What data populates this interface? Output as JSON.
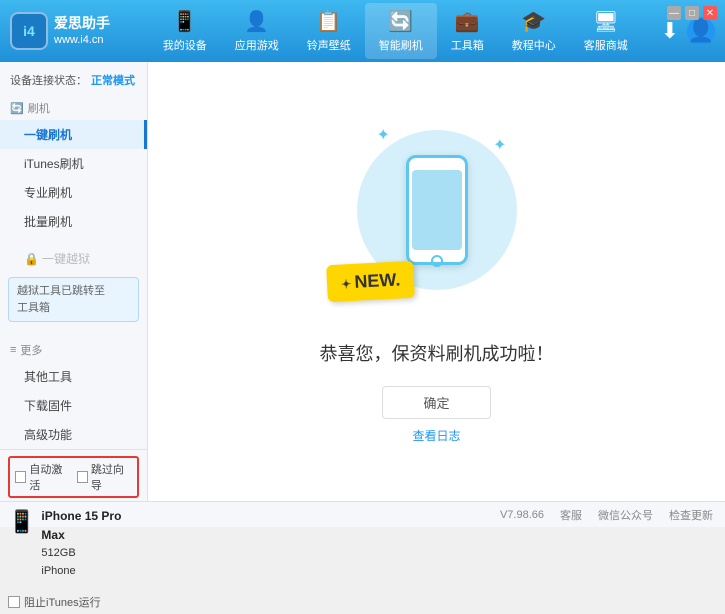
{
  "header": {
    "logo_icon": "i4",
    "logo_name": "爱思助手",
    "logo_url": "www.i4.cn",
    "nav": [
      {
        "id": "my-device",
        "icon": "📱",
        "label": "我的设备"
      },
      {
        "id": "app-games",
        "icon": "👤",
        "label": "应用游戏"
      },
      {
        "id": "ringtone",
        "icon": "📋",
        "label": "铃声壁纸"
      },
      {
        "id": "smart-flash",
        "icon": "🔄",
        "label": "智能刷机",
        "active": true
      },
      {
        "id": "toolbox",
        "icon": "💼",
        "label": "工具箱"
      },
      {
        "id": "tutorial",
        "icon": "🎓",
        "label": "教程中心"
      },
      {
        "id": "service",
        "icon": "🖥",
        "label": "客服商城"
      }
    ],
    "download_icon": "⬇",
    "user_icon": "👤"
  },
  "sidebar": {
    "status_label": "设备连接状态：",
    "status_value": "正常模式",
    "sections": [
      {
        "id": "flash",
        "icon": "🔄",
        "label": "刷机",
        "items": [
          {
            "id": "one-click-flash",
            "label": "一键刷机",
            "active": true
          },
          {
            "id": "itunes-flash",
            "label": "iTunes刷机"
          },
          {
            "id": "pro-flash",
            "label": "专业刷机"
          },
          {
            "id": "batch-flash",
            "label": "批量刷机"
          }
        ]
      }
    ],
    "disabled_item": "一键越狱",
    "notice_line1": "越狱工具已跳转至",
    "notice_line2": "工具箱",
    "more_label": "更多",
    "more_items": [
      {
        "id": "other-tools",
        "label": "其他工具"
      },
      {
        "id": "download-firmware",
        "label": "下载固件"
      },
      {
        "id": "advanced",
        "label": "高级功能"
      }
    ],
    "auto_options": [
      {
        "id": "auto-activate",
        "label": "自动激活"
      },
      {
        "id": "auto-guide",
        "label": "跳过向导"
      }
    ],
    "device": {
      "name": "iPhone 15 Pro Max",
      "storage": "512GB",
      "type": "iPhone"
    },
    "itunes_label": "阻止iTunes运行"
  },
  "main": {
    "success_text": "恭喜您，保资料刷机成功啦！",
    "confirm_btn": "确定",
    "log_link": "查看日志"
  },
  "footer": {
    "version": "V7.98.66",
    "items": [
      "客服",
      "微信公众号",
      "检查更新"
    ]
  }
}
